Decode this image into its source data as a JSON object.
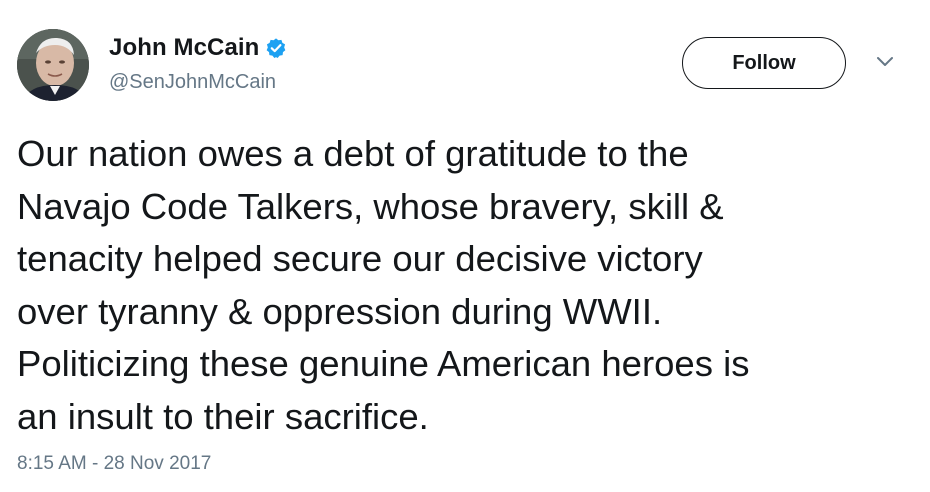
{
  "user": {
    "display_name": "John McCain",
    "handle": "@SenJohnMcCain",
    "verified": true
  },
  "actions": {
    "follow_label": "Follow"
  },
  "icons": {
    "verified": "verified-badge-icon",
    "menu": "chevron-down-icon"
  },
  "tweet": {
    "text": "Our nation owes a debt of gratitude to the\nNavajo Code Talkers, whose bravery, skill &\ntenacity helped secure our decisive victory\nover tyranny & oppression during WWII.\nPoliticizing these genuine American heroes is\nan insult to their sacrifice.",
    "timestamp": "8:15 AM - 28 Nov 2017"
  },
  "colors": {
    "text": "#14171a",
    "secondary": "#657786",
    "verified_blue": "#1da1f2"
  }
}
